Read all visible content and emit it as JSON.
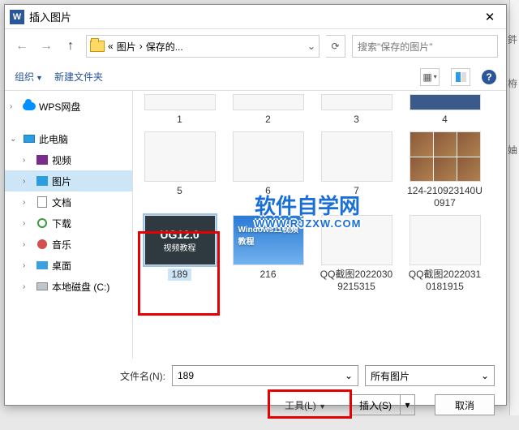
{
  "dialog": {
    "title": "插入图片"
  },
  "nav": {
    "path_prefix": "«",
    "path_seg1": "图片",
    "path_sep": "›",
    "path_seg2": "保存的...",
    "search_placeholder": "搜索\"保存的图片\""
  },
  "toolbar": {
    "organize": "组织",
    "newfolder": "新建文件夹"
  },
  "tree": {
    "wps": "WPS网盘",
    "pc": "此电脑",
    "video": "视频",
    "pictures": "图片",
    "docs": "文档",
    "downloads": "下载",
    "music": "音乐",
    "desktop": "桌面",
    "disk_c": "本地磁盘 (C:)"
  },
  "files": {
    "r1": [
      "1",
      "2",
      "3",
      "4"
    ],
    "r2": [
      "5",
      "6",
      "7",
      "124-210923140U0917"
    ],
    "r3": [
      "189",
      "216",
      "QQ截图20220309215315",
      "QQ截图20220310181915"
    ]
  },
  "thumb": {
    "ug_title": "UG12.0",
    "ug_sub": "视频教程",
    "win_title": "Windows11视频教程"
  },
  "watermark": {
    "main": "软件自学网",
    "sub": "WWW.RJZXW.COM"
  },
  "footer": {
    "filename_label": "文件名(N):",
    "filename_value": "189",
    "filter": "所有图片",
    "tools": "工具(L)",
    "insert": "插入(S)",
    "cancel": "取消"
  },
  "side": {
    "a": "鈝",
    "b": "栫",
    "c": "妯"
  }
}
